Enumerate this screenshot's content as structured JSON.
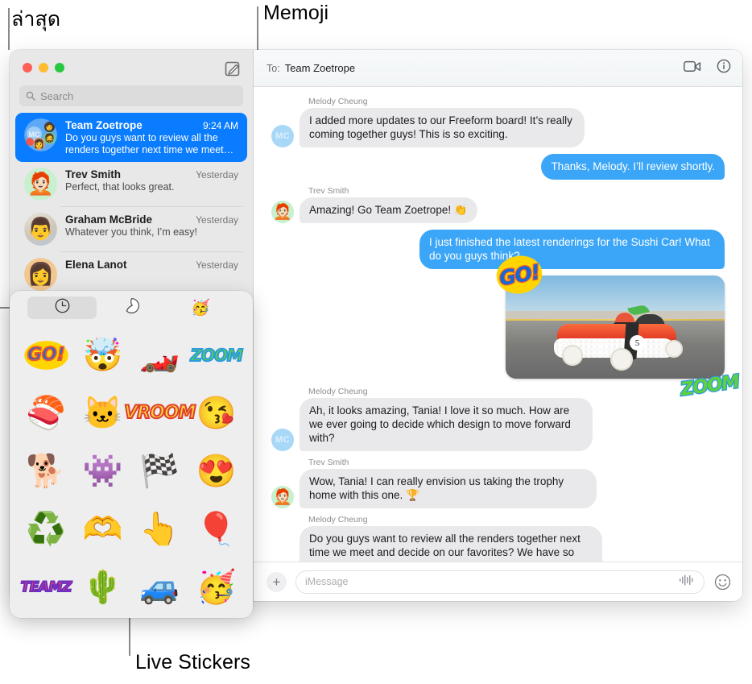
{
  "callouts": [
    {
      "id": "recent",
      "label": "ล่าสุด"
    },
    {
      "id": "memoji",
      "label": "Memoji"
    },
    {
      "id": "live_stickers",
      "label": "Live Stickers"
    }
  ],
  "sidebar": {
    "traffic_lights": {
      "close": "close-button",
      "minimize": "minimize-button",
      "zoom": "zoom-button"
    },
    "compose_label": "compose-icon",
    "search": {
      "placeholder": "Search",
      "icon": "search-icon"
    },
    "conversations": [
      {
        "name": "Team Zoetrope",
        "time": "9:24 AM",
        "preview": "Do you guys want to review all the renders together next time we meet…",
        "selected": true,
        "avatar_type": "group",
        "avatar_initials": "MC"
      },
      {
        "name": "Trev Smith",
        "time": "Yesterday",
        "preview": "Perfect, that looks great.",
        "selected": false,
        "avatar_type": "memoji",
        "avatar_glyph": "🧑🏻‍🦰"
      },
      {
        "name": "Graham McBride",
        "time": "Yesterday",
        "preview": "Whatever you think, I’m easy!",
        "selected": false,
        "avatar_type": "photo",
        "avatar_glyph": "👨"
      },
      {
        "name": "Elena Lanot",
        "time": "Yesterday",
        "preview": "",
        "selected": false,
        "avatar_type": "photo-tan",
        "avatar_glyph": "👩"
      }
    ]
  },
  "conversation": {
    "to_label": "To:",
    "to_name": "Team Zoetrope",
    "facetime_icon": "video-camera-icon",
    "info_icon": "info-icon",
    "messages": [
      {
        "sender": "Melody Cheung",
        "direction": "in",
        "avatar": "MC",
        "text": "I added more updates to our Freeform board! It’s really coming together guys! This is so exciting."
      },
      {
        "sender": "",
        "direction": "out",
        "text": "Thanks, Melody. I’ll review shortly."
      },
      {
        "sender": "Trev Smith",
        "direction": "in",
        "avatar": "memoji",
        "text": "Amazing! Go Team Zoetrope! 👏"
      },
      {
        "sender": "",
        "direction": "out",
        "text": "I just finished the latest renderings for the Sushi Car! What do you guys think?"
      },
      {
        "sender": "",
        "direction": "out",
        "type": "photo",
        "alt": "sushi-race-car-photo",
        "stickers": [
          "GO!",
          "ZOOM"
        ]
      },
      {
        "sender": "Melody Cheung",
        "direction": "in",
        "avatar": "MC",
        "text": "Ah, it looks amazing, Tania! I love it so much. How are we ever going to decide which design to move forward with?"
      },
      {
        "sender": "Trev Smith",
        "direction": "in",
        "avatar": "memoji",
        "text": "Wow, Tania! I can really envision us taking the trophy home with this one. 🏆"
      },
      {
        "sender": "Melody Cheung",
        "direction": "in",
        "avatar": "MC",
        "text": "Do you guys want to review all the renders together next time we meet and decide on our favorites? We have so much amazing work now, just need to make some decisions."
      }
    ],
    "composer": {
      "plus_label": "+",
      "placeholder": "iMessage",
      "audio_icon": "audio-waveform-icon",
      "emoji_icon": "emoji-smiley-icon"
    }
  },
  "sticker_picker": {
    "tabs": [
      {
        "id": "recents",
        "icon": "clock-icon",
        "glyph": "clock",
        "active": true
      },
      {
        "id": "stickers",
        "icon": "live-sticker-peel-icon",
        "glyph": "peel",
        "active": false
      },
      {
        "id": "memoji",
        "icon": "memoji-face-icon",
        "glyph": "🥳",
        "active": false
      }
    ],
    "stickers": [
      {
        "name": "go-sticker",
        "kind": "art",
        "glyph": "GO!"
      },
      {
        "name": "mind-blown-memoji",
        "kind": "emoji",
        "glyph": "🤯"
      },
      {
        "name": "racing-car-sticker",
        "kind": "emoji",
        "glyph": "🏎️"
      },
      {
        "name": "zoom-sticker",
        "kind": "art",
        "glyph": "ZOOM"
      },
      {
        "name": "sushi-sticker",
        "kind": "emoji",
        "glyph": "🍣"
      },
      {
        "name": "grumpy-cat-sticker",
        "kind": "emoji",
        "glyph": "🐱"
      },
      {
        "name": "flame-car-sticker",
        "kind": "art",
        "glyph": "VROOM"
      },
      {
        "name": "kiss-memoji",
        "kind": "emoji",
        "glyph": "😘"
      },
      {
        "name": "dog-sunglasses-sticker",
        "kind": "emoji",
        "glyph": "🐕"
      },
      {
        "name": "monster-teeth-sticker",
        "kind": "emoji",
        "glyph": "👾"
      },
      {
        "name": "checkered-flag-sticker",
        "kind": "emoji",
        "glyph": "🏁"
      },
      {
        "name": "heart-eyes-memoji",
        "kind": "emoji",
        "glyph": "😍"
      },
      {
        "name": "recycle-sticker",
        "kind": "emoji",
        "glyph": "♻️"
      },
      {
        "name": "heart-hands-memoji",
        "kind": "emoji",
        "glyph": "🫶"
      },
      {
        "name": "foam-finger-sticker",
        "kind": "emoji",
        "glyph": "👆"
      },
      {
        "name": "hot-air-balloon-sticker",
        "kind": "emoji",
        "glyph": "🎈"
      },
      {
        "name": "teamz-sticker",
        "kind": "art",
        "glyph": "TEAMZ"
      },
      {
        "name": "cactus-sticker",
        "kind": "emoji",
        "glyph": "🌵"
      },
      {
        "name": "blue-car-sticker",
        "kind": "emoji",
        "glyph": "🚙"
      },
      {
        "name": "party-memoji",
        "kind": "emoji",
        "glyph": "🥳"
      }
    ]
  },
  "colors": {
    "accent_blue": "#0a7cff",
    "bubble_out": "#3ba6f7",
    "bubble_in": "#e9e9eb",
    "sidebar_bg": "#e8e8e8",
    "picker_bg": "#eeeeee"
  }
}
